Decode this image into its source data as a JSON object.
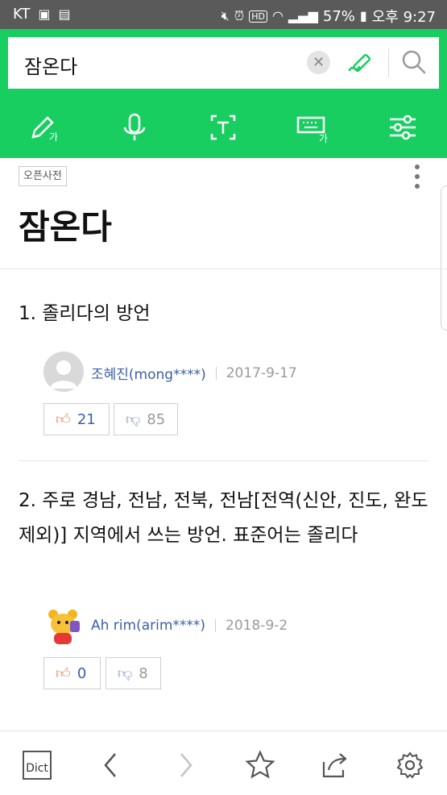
{
  "status_bar": {
    "carrier": "KT",
    "hd_badge": "HD",
    "battery_percent": "57%",
    "time": "오후 9:27"
  },
  "search": {
    "query": "잠온다"
  },
  "entry": {
    "source_badge": "오픈사전",
    "title": "잠온다"
  },
  "definitions": [
    {
      "text": "1. 졸리다의 방언",
      "author": "조혜진(mong****)",
      "date": "2017-9-17",
      "likes": "21",
      "dislikes": "85"
    },
    {
      "text": "2. 주로 경남, 전남, 전북, 전남[전역(신안, 진도, 완도 제외)] 지역에서 쓰는 방언. 표준어는 졸리다",
      "author": "Ah rim(arim****)",
      "date": "2018-9-2",
      "likes": "0",
      "dislikes": "8"
    }
  ],
  "toolbar_icons": [
    "handwriting-icon",
    "microphone-icon",
    "text-recognition-icon",
    "keyboard-icon",
    "settings-sliders-icon"
  ],
  "bottom_bar": {
    "dict_label": "Dict"
  },
  "colors": {
    "brand_green": "#19ce60",
    "status_bar": "#5a5a5a",
    "author_link": "#3b5fa8"
  }
}
